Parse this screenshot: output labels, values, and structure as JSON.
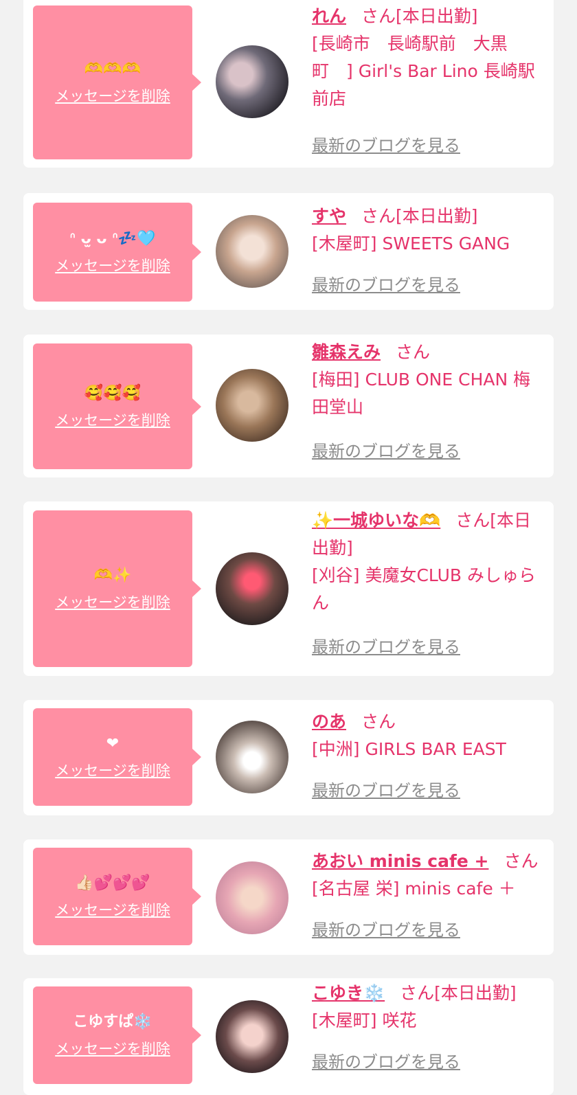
{
  "common": {
    "delete_label": "メッセージを削除",
    "san": "さん",
    "blog_label": "最新のブログを見る",
    "colors": {
      "background": "#f2f2f2",
      "card": "#ffffff",
      "bubble": "#ff8fa3",
      "accent_pink": "#e5336a",
      "link_gray": "#8c8c8c"
    }
  },
  "entries": [
    {
      "message": "🫶🫶🫶",
      "name": "れん",
      "status": "[本日出勤]",
      "store": "[長崎市　長崎駅前　大黒町　] Girl's Bar Lino 長崎駅前店"
    },
    {
      "message": "ᐢ ᴗ̫ ᴗ ᐢ💤🩵",
      "name": "すや",
      "status": "[本日出勤]",
      "store": "[木屋町] SWEETS GANG"
    },
    {
      "message": "🥰🥰🥰",
      "name": "雛森えみ",
      "status": "",
      "store": "[梅田] CLUB ONE CHAN 梅田堂山"
    },
    {
      "message": "🫶✨",
      "name": "✨一城ゆいな🫶",
      "status": "[本日出勤]",
      "store": "[刈谷] 美魔女CLUB みしゅらん"
    },
    {
      "message": "❤",
      "name": "のあ",
      "status": "",
      "store": "[中洲] GIRLS BAR EAST"
    },
    {
      "message": "👍🏻💕💕💕",
      "name": "あおい minis cafe +",
      "status": "",
      "store": "[名古屋 栄] minis cafe ＋"
    },
    {
      "message": "こゆすぱ❄️",
      "name": "こゆき❄️",
      "status": "[本日出勤]",
      "store": "[木屋町] 咲花"
    }
  ]
}
